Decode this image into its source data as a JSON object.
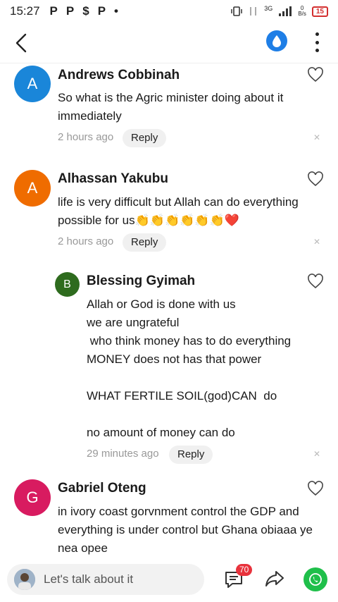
{
  "status_bar": {
    "time": "15:27",
    "notif_icons": [
      "P",
      "P",
      "$",
      "P",
      "•"
    ],
    "network": "3G",
    "speed": "0\nB/s",
    "battery": "15"
  },
  "header": {
    "back_icon": "chevron-left-icon",
    "drop_icon": "water-drop-icon",
    "more_icon": "vertical-dots-icon"
  },
  "comments": [
    {
      "initial": "A",
      "avatar_color": "#1a86d9",
      "name": "Andrews Cobbinah",
      "text": "So what is the Agric minister doing about it\nimmediately",
      "time": "2 hours ago",
      "reply": "Reply"
    },
    {
      "initial": "A",
      "avatar_color": "#ef6c00",
      "name": "Alhassan Yakubu",
      "text": "life is very difficult but Allah can do everything\npossible for us👏👏👏👏👏👏❤️",
      "time": "2 hours ago",
      "reply": "Reply"
    },
    {
      "initial": "B",
      "avatar_color": "#2e6b1e",
      "name": "Blessing Gyimah",
      "text": "Allah or God is done with us\nwe are ungrateful\n who think money has to do everything\nMONEY does not has that power\n\nWHAT FERTILE SOIL(god)CAN  do\n\nno amount of money can do",
      "time": "29 minutes ago",
      "reply": "Reply"
    },
    {
      "initial": "G",
      "avatar_color": "#d81b60",
      "name": "Gabriel Oteng",
      "text": "in ivory coast gorvnment control the GDP and\neverything is under control but Ghana obiaaa ye\nnea opee"
    }
  ],
  "bottom_bar": {
    "placeholder": "Let's talk about it",
    "comment_count": "70"
  }
}
